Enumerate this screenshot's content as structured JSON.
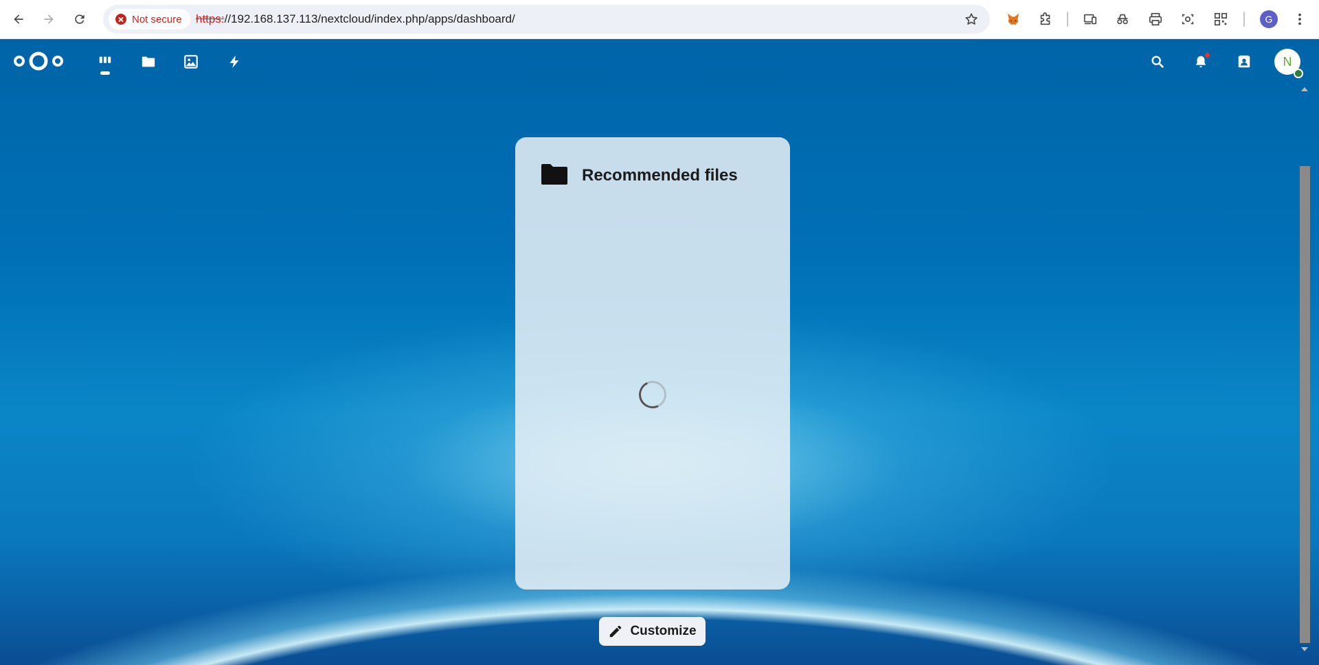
{
  "browser": {
    "security_label": "Not secure",
    "url_scheme": "https:",
    "url_rest": "//192.168.137.113/nextcloud/index.php/apps/dashboard/",
    "profile_initial": "G",
    "toolbar_icons": [
      "back-icon",
      "forward-icon",
      "reload-icon",
      "bookmark-star-icon",
      "metamask-fox-icon",
      "extensions-puzzle-icon",
      "devices-icon",
      "incognito-glasses-icon",
      "print-icon",
      "screenshot-icon",
      "qr-code-icon",
      "more-menu-icon"
    ]
  },
  "nextcloud": {
    "apps": [
      "dashboard-icon",
      "files-icon",
      "photos-icon",
      "activity-icon"
    ],
    "header_right": [
      "search-icon",
      "notifications-icon",
      "contacts-icon"
    ],
    "avatar_initial": "N",
    "colors": {
      "avatar_text": "#5fab2d",
      "status_online": "#2d7b41",
      "notification_dot": "#e9322d",
      "accent_blue": "#0070b6"
    }
  },
  "widget": {
    "title": "Recommended files",
    "icon": "folder-icon",
    "state": "loading"
  },
  "customize_button": {
    "label": "Customize",
    "icon": "pencil-icon"
  }
}
